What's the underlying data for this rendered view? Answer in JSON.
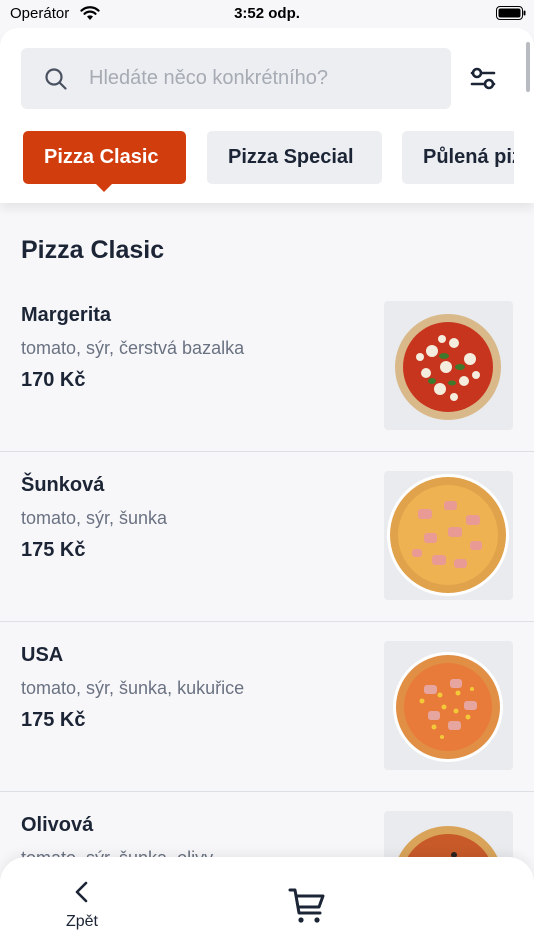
{
  "status_bar": {
    "carrier": "Operátor",
    "time": "3:52 odp."
  },
  "search": {
    "placeholder": "Hledáte něco konkrétního?",
    "value": ""
  },
  "tabs": [
    {
      "label": "Pizza Clasic",
      "active": true
    },
    {
      "label": "Pizza Special",
      "active": false
    },
    {
      "label": "Půlená pizza",
      "active": false
    }
  ],
  "section_title": "Pizza Clasic",
  "items": [
    {
      "name": "Margerita",
      "description": "tomato, sýr, čerstvá bazalka",
      "price": "170 Kč",
      "image": "margherita-pizza"
    },
    {
      "name": "Šunková",
      "description": "tomato, sýr, šunka",
      "price": "175 Kč",
      "image": "ham-pizza"
    },
    {
      "name": "USA",
      "description": "tomato, sýr, šunka, kukuřice",
      "price": "175 Kč",
      "image": "ham-corn-pizza"
    },
    {
      "name": "Olivová",
      "description": "tomato, sýr, šunka, olivy",
      "price": "",
      "image": "olive-pizza"
    }
  ],
  "bottom_nav": {
    "back_label": "Zpět",
    "cart_icon": "cart-icon"
  },
  "colors": {
    "accent": "#d23d0d",
    "text": "#1c2536",
    "muted": "#6a7282",
    "field": "#eceef1"
  }
}
